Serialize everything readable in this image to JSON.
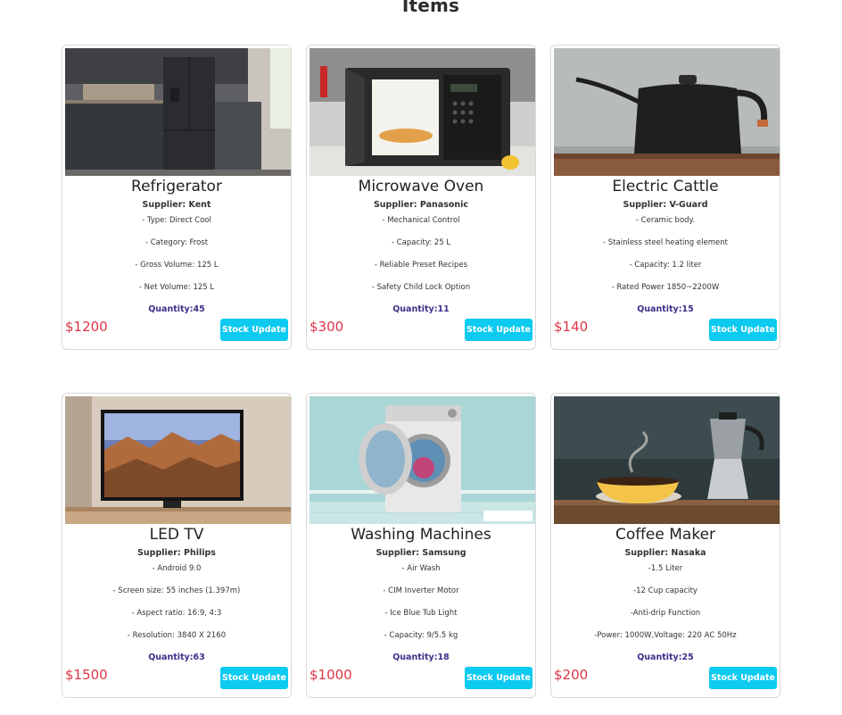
{
  "page": {
    "title": "Items"
  },
  "button_label": "Stock Update",
  "colors": {
    "accent": "#0dcaf0",
    "price": "#dc3545",
    "quantity": "#3b2f8a"
  },
  "items": [
    {
      "name": "Refrigerator",
      "supplier": "Supplier: Kent",
      "description": [
        "- Type: Direct Cool",
        "- Category: Frost",
        "- Gross Volume: 125 L",
        "- Net Volume: 125 L"
      ],
      "quantity": "Quantity:45",
      "price": "$1200"
    },
    {
      "name": "Microwave Oven",
      "supplier": "Supplier: Panasonic",
      "description": [
        "- Mechanical Control",
        "- Capacity: 25 L",
        "- Reliable Preset Recipes",
        "- Safety Child Lock Option"
      ],
      "quantity": "Quantity:11",
      "price": "$300"
    },
    {
      "name": "Electric Cattle",
      "supplier": "Supplier: V-Guard",
      "description": [
        "- Ceramic body.",
        "- Stainless steel heating element",
        "- Capacity: 1.2 liter",
        "- Rated Power 1850~2200W"
      ],
      "quantity": "Quantity:15",
      "price": "$140"
    },
    {
      "name": "LED TV",
      "supplier": "Supplier: Philips",
      "description": [
        "- Android 9.0",
        "- Screen size: 55 inches (1.397m)",
        "- Aspect ratio: 16:9, 4:3",
        "- Resolution: 3840 X 2160"
      ],
      "quantity": "Quantity:63",
      "price": "$1500"
    },
    {
      "name": "Washing Machines",
      "supplier": "Supplier: Samsung",
      "description": [
        "- Air Wash",
        "- CIM Inverter Motor",
        "- Ice Blue Tub Light",
        "- Capacity: 9/5.5 kg"
      ],
      "quantity": "Quantity:18",
      "price": "$1000"
    },
    {
      "name": "Coffee Maker",
      "supplier": "Supplier: Nasaka",
      "description": [
        "-1.5 Liter",
        "-12 Cup capacity",
        "-Anti-drip Function",
        "-Power: 1000W,Voltage: 220 AC 50Hz"
      ],
      "quantity": "Quantity:25",
      "price": "$200"
    }
  ]
}
